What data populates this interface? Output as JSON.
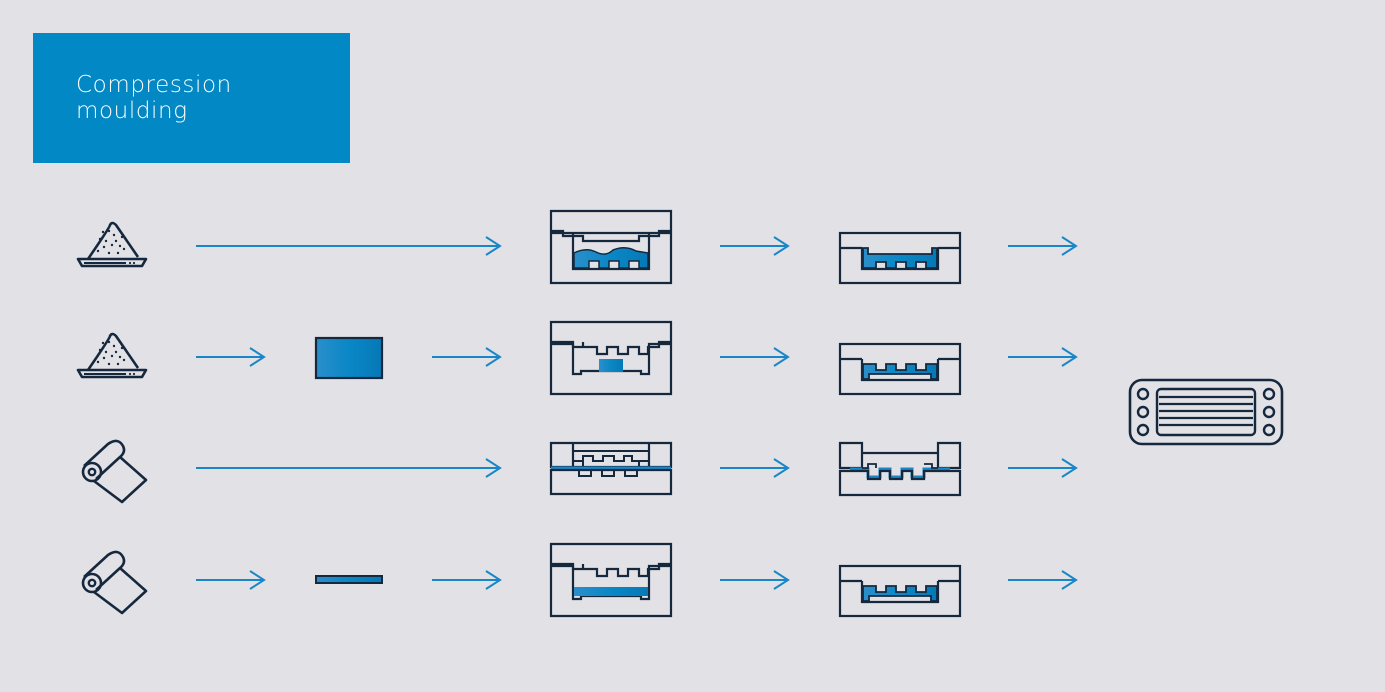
{
  "title": {
    "line1": "Compression",
    "line2": "moulding"
  },
  "colors": {
    "background": "#e2e1e6",
    "title_box": "#0288c5",
    "accent_blue": "#1a86c8",
    "outline": "#15283d"
  },
  "rows": [
    {
      "input": "powder",
      "intermediate": "none",
      "mould": "open-mould-liquid-fill",
      "result": "closed-mould-part"
    },
    {
      "input": "powder",
      "intermediate": "preform-block",
      "mould": "open-mould-preform",
      "result": "closed-mould-part"
    },
    {
      "input": "sheet-roll",
      "intermediate": "none",
      "mould": "closing-mould-sheet",
      "result": "closed-mould-formed-sheet"
    },
    {
      "input": "sheet-roll",
      "intermediate": "thin-strip",
      "mould": "open-mould-strip",
      "result": "closed-mould-part"
    }
  ],
  "final_product": "moulded-grille-part"
}
